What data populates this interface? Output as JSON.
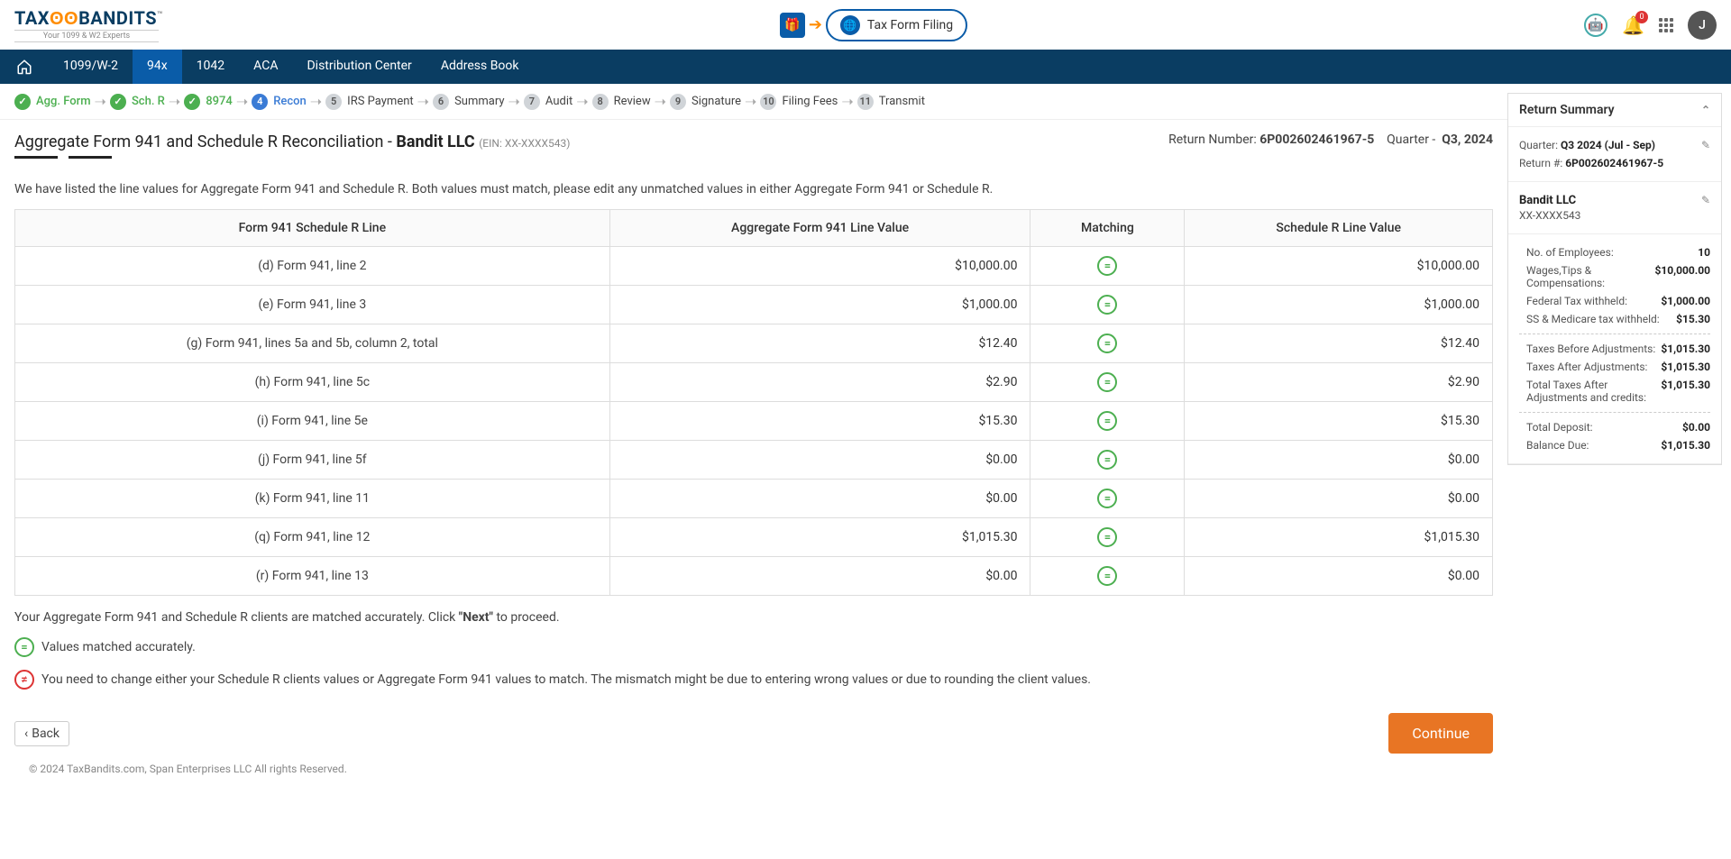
{
  "logo": {
    "sub": "Your 1099 & W2 Experts",
    "text_prefix": "TAX",
    "text_suffix": "BANDITS"
  },
  "top": {
    "tax_form_filing": "Tax Form Filing",
    "notification_count": "0",
    "avatar_letter": "J"
  },
  "nav": [
    "1099/W-2",
    "94x",
    "1042",
    "ACA",
    "Distribution Center",
    "Address Book"
  ],
  "active_nav_index": 1,
  "workflow": [
    {
      "label": "Agg. Form",
      "status": "done"
    },
    {
      "label": "Sch. R",
      "status": "done"
    },
    {
      "label": "8974",
      "status": "done"
    },
    {
      "label": "Recon",
      "status": "active",
      "num": "4"
    },
    {
      "label": "IRS Payment",
      "status": "future",
      "num": "5"
    },
    {
      "label": "Summary",
      "status": "future",
      "num": "6"
    },
    {
      "label": "Audit",
      "status": "future",
      "num": "7"
    },
    {
      "label": "Review",
      "status": "future",
      "num": "8"
    },
    {
      "label": "Signature",
      "status": "future",
      "num": "9"
    },
    {
      "label": "Filing Fees",
      "status": "future",
      "num": "10"
    },
    {
      "label": "Transmit",
      "status": "future",
      "num": "11"
    }
  ],
  "page": {
    "title_prefix": "Aggregate Form 941 and Schedule R Reconciliation  -  ",
    "company": "Bandit LLC",
    "ein": "(EIN: XX-XXXX543)",
    "return_number_label": "Return Number: ",
    "return_number": "6P002602461967-5",
    "quarter_label": "Quarter - ",
    "quarter": "Q3, 2024",
    "note": "We have listed the line values for Aggregate Form 941 and Schedule R. Both values must match, please edit any unmatched values in either Aggregate Form 941 or Schedule R.",
    "proceed_prefix": "Your Aggregate Form 941 and Schedule R clients are matched accurately. Click ",
    "proceed_bold": "\"Next\"",
    "proceed_suffix": " to proceed.",
    "legend_match": "Values matched accurately.",
    "legend_mismatch": "You need to change either your Schedule R clients values or Aggregate Form 941 values to match. The mismatch might be due to entering wrong values or due to rounding the client values.",
    "back": "Back",
    "continue": "Continue"
  },
  "table": {
    "headers": [
      "Form 941 Schedule R Line",
      "Aggregate Form 941 Line Value",
      "Matching",
      "Schedule R Line Value"
    ],
    "rows": [
      {
        "label": "(d) Form 941, line 2",
        "agg": "$10,000.00",
        "sr": "$10,000.00",
        "match": true
      },
      {
        "label": "(e) Form 941, line 3",
        "agg": "$1,000.00",
        "sr": "$1,000.00",
        "match": true
      },
      {
        "label": "(g) Form 941, lines 5a and 5b, column 2, total",
        "agg": "$12.40",
        "sr": "$12.40",
        "match": true
      },
      {
        "label": "(h) Form 941, line 5c",
        "agg": "$2.90",
        "sr": "$2.90",
        "match": true
      },
      {
        "label": "(i) Form 941, line 5e",
        "agg": "$15.30",
        "sr": "$15.30",
        "match": true
      },
      {
        "label": "(j) Form 941, line 5f",
        "agg": "$0.00",
        "sr": "$0.00",
        "match": true
      },
      {
        "label": "(k) Form 941, line 11",
        "agg": "$0.00",
        "sr": "$0.00",
        "match": true
      },
      {
        "label": "(q) Form 941, line 12",
        "agg": "$1,015.30",
        "sr": "$1,015.30",
        "match": true
      },
      {
        "label": "(r) Form 941, line 13",
        "agg": "$0.00",
        "sr": "$0.00",
        "match": true
      }
    ]
  },
  "sidebar": {
    "title": "Return Summary",
    "quarter_label": "Quarter:",
    "quarter": "Q3 2024 (Jul - Sep)",
    "return_label": "Return #:",
    "return": "6P002602461967-5",
    "company": "Bandit LLC",
    "ein": "XX-XXXX543",
    "rows1": [
      {
        "label": "No. of Employees:",
        "val": "10"
      },
      {
        "label": "Wages,Tips & Compensations:",
        "val": "$10,000.00"
      },
      {
        "label": "Federal Tax withheld:",
        "val": "$1,000.00"
      },
      {
        "label": "SS & Medicare tax withheld:",
        "val": "$15.30"
      }
    ],
    "rows2": [
      {
        "label": "Taxes Before Adjustments:",
        "val": "$1,015.30"
      },
      {
        "label": "Taxes After Adjustments:",
        "val": "$1,015.30"
      },
      {
        "label": "Total Taxes After Adjustments and credits:",
        "val": "$1,015.30"
      }
    ],
    "rows3": [
      {
        "label": "Total Deposit:",
        "val": "$0.00"
      },
      {
        "label": "Balance Due:",
        "val": "$1,015.30"
      }
    ]
  },
  "footer": "© 2024 TaxBandits.com, Span Enterprises LLC All rights Reserved."
}
